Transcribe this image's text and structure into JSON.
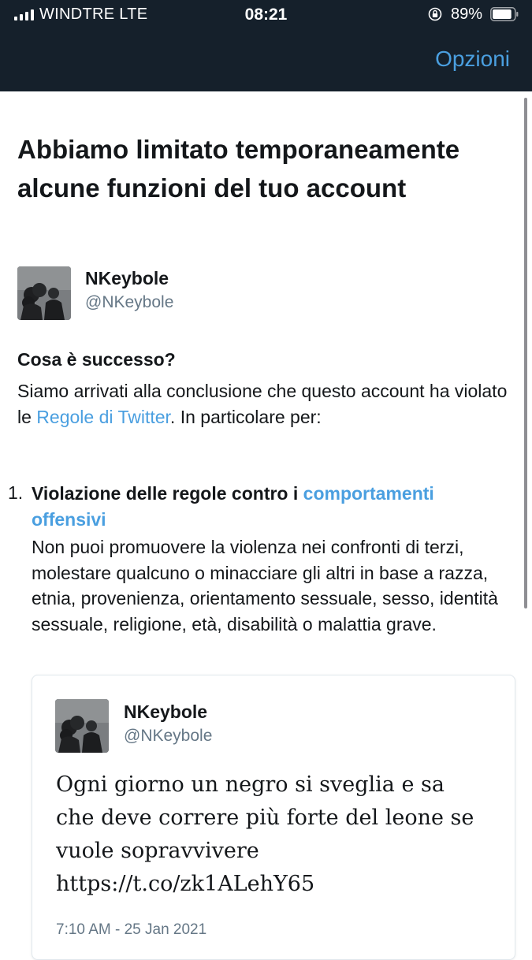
{
  "status_bar": {
    "carrier": "WINDTRE  LTE",
    "time": "08:21",
    "battery_percent": "89%",
    "battery_level": 0.89
  },
  "header": {
    "options_label": "Opzioni",
    "background_color": "#15202b",
    "accent_color": "#4a9fe0"
  },
  "page": {
    "title": "Abbiamo limitato temporaneamente alcune funzioni del tuo account"
  },
  "account": {
    "name": "NKeybole",
    "handle": "@NKeybole"
  },
  "what_happened": {
    "heading": "Cosa è successo?",
    "text_before_link": "Siamo arrivati alla conclusione che questo account ha violato le ",
    "link_text": "Regole di Twitter",
    "text_after_link": ". In particolare per:"
  },
  "violation": {
    "number": "1.",
    "heading_prefix": "Violazione delle regole contro i ",
    "heading_link": "comportamenti offensivi",
    "description": "Non puoi promuovere la violenza nei confronti di terzi, molestare qualcuno o minacciare gli altri in base a razza, etnia, provenienza, orientamento sessuale, sesso, identità sessuale, religione, età, disabilità o malattia grave."
  },
  "tweet": {
    "author_name": "NKeybole",
    "author_handle": "@NKeybole",
    "text_line1": "Ogni giorno un negro si sveglia e sa",
    "text_line2": "che deve correre più forte del leone se",
    "text_line3": "vuole sopravvivere",
    "text_line4": "https://t.co/zk1ALehY65",
    "timestamp": "7:10 AM - 25 Jan 2021"
  },
  "icons": {
    "signal": "cellular-signal-icon",
    "rotation_lock": "rotation-lock-icon",
    "battery": "battery-icon"
  }
}
